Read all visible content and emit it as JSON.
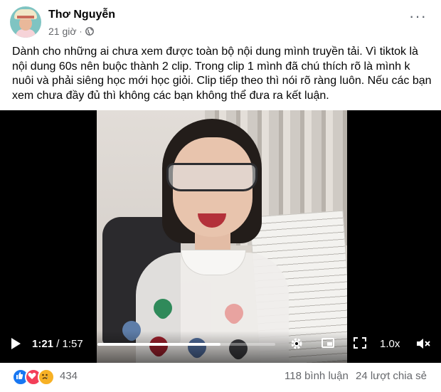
{
  "post": {
    "author": "Thơ Nguyễn",
    "time": "21 giờ",
    "separator": "·",
    "audience_icon": "globe-icon",
    "more_icon": "more-horizontal-icon",
    "more_label": "···",
    "text": "Dành cho những ai chưa xem được toàn bộ nội dung mình truyền tải. Vì tiktok là nội dung 60s nên buộc thành 2 clip. Trong clip 1 mình đã chú thích rõ là mình k nuôi và phải siêng học mới học giỏi. Clip tiếp theo thì nói rõ ràng luôn. Nếu các bạn xem chưa đầy đủ thì không các bạn không thể đưa ra kết luận."
  },
  "video": {
    "current_time": "1:21",
    "separator": " / ",
    "total_time": "1:57",
    "progress": 0.69,
    "speed": "1.0x",
    "icons": {
      "play": "play-icon",
      "settings": "gear-icon",
      "pip": "picture-in-picture-icon",
      "fullscreen": "expand-icon",
      "volume": "mute-icon"
    }
  },
  "footer": {
    "reactions": [
      "like",
      "love",
      "sad"
    ],
    "reaction_count": "434",
    "comments": "118 bình luận",
    "shares": "24 lượt chia sẻ"
  },
  "colors": {
    "like": "#1877f2",
    "love": "#f33e58",
    "sad": "#f7b125",
    "secondary_text": "#65676b"
  }
}
